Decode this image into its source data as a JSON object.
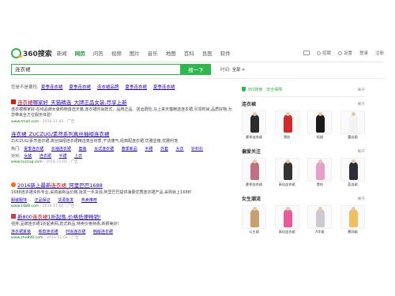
{
  "nav": {
    "logo_text": "360搜索",
    "tabs": [
      "新闻",
      "网页",
      "问答",
      "视频",
      "图片",
      "音乐",
      "地图",
      "百科",
      "良医",
      "软件"
    ],
    "active_tab": "网页",
    "right_items": [
      "招聘",
      "设置",
      "登录",
      "注册"
    ]
  },
  "search": {
    "query": "连衣裙",
    "button_label": "搜一下",
    "time_label": "时间:",
    "time_value": "全部"
  },
  "related": {
    "label": "您是不是要找:",
    "items": [
      "夏季连衣裙",
      "夏季连衣裙",
      "连衣裙品牌",
      "夏季连衣裙",
      "夏季连衣裙"
    ]
  },
  "results": [
    {
      "title_kw": "连衣裙",
      "title_rest": "哪家好_天猫精选_大牌正品女装,尽享上新",
      "desc": "连衣裙哪家好-在线品牌女装购物首选天猫,连衣裙时尚款式、品牌正品、送运费险,马上来天猫精选连衣裙,引领时尚,品质好物,为您带来全方位服务体验!",
      "url": "www.tmall.com",
      "date": "- 2016-11-02 - 广告"
    },
    {
      "title": "连衣裙_ZUCZUG/素然系列真丝抽褶连衣裙",
      "desc": "ZUCZUG/素然连衣裙,真丝抽褶连衣裙精选真丝材质,干货蓬气,经典配连衣裙,优雅显瘦,优雅利落",
      "subs": [
        "夏季连衣裙",
        "长袖连衣裙",
        "套装",
        "女式连衣裙",
        "春季新品",
        "半裙",
        "外套",
        "大衣",
        "针织衫"
      ],
      "subs2_label": "对对:",
      "subs2": [
        "女装",
        "连衣裙",
        "半裙",
        "上衣"
      ],
      "url": "www.zuczug.com",
      "date": "- 2016-11-02 - 广告"
    },
    {
      "title_prefix": "2016新上最新",
      "title_kw": "连衣裙",
      "title_rest": "_阿里巴巴1688",
      "desc": "1688连衣裙资料专业,采购最新品价格,批发一手货源,阿里巴巴提供海量优质连衣裙产品,采购就上1688!",
      "subs": [
        "服装服饰",
        "正品保证",
        "货源批发",
        "热卖推荐"
      ],
      "url": "www.1688.com",
      "date": "- 2016-11-02 - 广告"
    },
    {
      "title_prefix": "新800",
      "title_kw": "连衣裙",
      "title_rest": "1折起售,价格低便畅销!",
      "desc": "强排,品牌连衣裙1折起卖网,款式新品,特卖价格特惠,新颖美好!",
      "subs": [
        "连衣裙夏装",
        "新款连衣裙",
        "时尚连衣裙",
        "韩版连衣裙"
      ],
      "url": "www.zhe800.com",
      "date": "- 2016-11-02 - 广告"
    }
  ],
  "right_panel": {
    "header_text": "360搜索 · 安全保障",
    "more_label": "展开",
    "sections": [
      {
        "title": "连衣裙",
        "more": "展开",
        "items": [
          "夏季连衣裙",
          "雪纺",
          "短裙",
          "蕾丝裙"
        ],
        "colors": [
          "#2c2c2c",
          "#d02a2a",
          "#1a1a1a",
          "#f3f3f3"
        ]
      },
      {
        "title": "偏爱关注",
        "more": "展开",
        "items": [
          "夏季连衣裙",
          "高佳连衣裙",
          "雪纺",
          "蓝连裙"
        ],
        "colors": [
          "#c07080",
          "#333333",
          "#e6a0c8",
          "#2d2d3a"
        ]
      },
      {
        "title": "女生潮流",
        "more": "展开",
        "items": [
          "公主裙",
          "高佳连衣裙",
          "A字裙",
          "蕉网裙"
        ],
        "colors": [
          "#c8a070",
          "#e85a9a",
          "#d0c8d0",
          "#f0c060"
        ]
      }
    ]
  }
}
